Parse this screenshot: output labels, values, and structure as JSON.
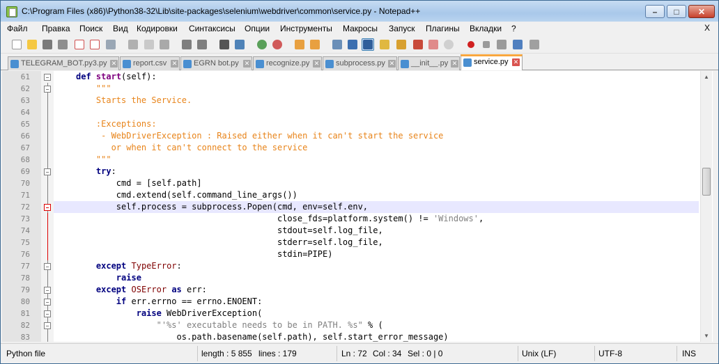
{
  "window": {
    "title": "C:\\Program Files (x86)\\Python38-32\\Lib\\site-packages\\selenium\\webdriver\\common\\service.py - Notepad++",
    "minimize": "–",
    "maximize": "□",
    "close": "✕"
  },
  "menu": {
    "items": [
      "Файл",
      "Правка",
      "Поиск",
      "Вид",
      "Кодировки",
      "Синтаксисы",
      "Опции",
      "Инструменты",
      "Макросы",
      "Запуск",
      "Плагины",
      "Вкладки",
      "?"
    ],
    "close": "X"
  },
  "toolbar": {
    "icons": [
      "new-file-icon",
      "open-file-icon",
      "save-icon",
      "save-all-icon",
      "close-icon",
      "close-all-icon",
      "print-icon",
      "cut-icon",
      "copy-icon",
      "paste-icon",
      "undo-icon",
      "redo-icon",
      "find-icon",
      "replace-icon",
      "zoom-in-icon",
      "zoom-out-icon",
      "sync-v-icon",
      "sync-h-icon",
      "word-wrap-icon",
      "show-all-chars-icon",
      "indent-guide-icon",
      "udl-icon",
      "doc-map-icon",
      "function-list-icon",
      "folder-workspace-icon",
      "monitoring-icon",
      "record-macro-icon",
      "stop-macro-icon",
      "play-macro-icon",
      "run-macro-multiple-icon",
      "save-macro-icon"
    ]
  },
  "tabs": [
    {
      "label": "TELEGRAM_BOT.py3.py",
      "active": false
    },
    {
      "label": "report.csv",
      "active": false
    },
    {
      "label": "EGRN bot.py",
      "active": false
    },
    {
      "label": "recognize.py",
      "active": false
    },
    {
      "label": "subprocess.py",
      "active": false
    },
    {
      "label": "__init__.py",
      "active": false
    },
    {
      "label": "service.py",
      "active": true
    }
  ],
  "editor": {
    "current_line": 72,
    "lines": [
      {
        "n": "61",
        "t": "def start(self):"
      },
      {
        "n": "62",
        "t": "    \"\"\""
      },
      {
        "n": "63",
        "t": "    Starts the Service."
      },
      {
        "n": "64",
        "t": ""
      },
      {
        "n": "65",
        "t": "    :Exceptions:"
      },
      {
        "n": "66",
        "t": "     - WebDriverException : Raised either when it can't start the service"
      },
      {
        "n": "67",
        "t": "       or when it can't connect to the service"
      },
      {
        "n": "68",
        "t": "    \"\"\""
      },
      {
        "n": "69",
        "t": "    try:"
      },
      {
        "n": "70",
        "t": "        cmd = [self.path]"
      },
      {
        "n": "71",
        "t": "        cmd.extend(self.command_line_args())"
      },
      {
        "n": "72",
        "t": "        self.process = subprocess.Popen(cmd, env=self.env,"
      },
      {
        "n": "73",
        "t": "                                        close_fds=platform.system() != 'Windows',"
      },
      {
        "n": "74",
        "t": "                                        stdout=self.log_file,"
      },
      {
        "n": "75",
        "t": "                                        stderr=self.log_file,"
      },
      {
        "n": "76",
        "t": "                                        stdin=PIPE)"
      },
      {
        "n": "77",
        "t": "    except TypeError:"
      },
      {
        "n": "78",
        "t": "        raise"
      },
      {
        "n": "79",
        "t": "    except OSError as err:"
      },
      {
        "n": "80",
        "t": "        if err.errno == errno.ENOENT:"
      },
      {
        "n": "81",
        "t": "            raise WebDriverException("
      },
      {
        "n": "82",
        "t": "                \"'%s' executable needs to be in PATH. %s\" % ("
      },
      {
        "n": "83",
        "t": "                    os.path.basename(self.path), self.start_error_message)"
      }
    ]
  },
  "status": {
    "language": "Python file",
    "length": "length : 5 855",
    "lines": "lines : 179",
    "ln": "Ln : 72",
    "col": "Col : 34",
    "sel": "Sel : 0 | 0",
    "eol": "Unix (LF)",
    "encoding": "UTF-8",
    "mode": "INS"
  }
}
